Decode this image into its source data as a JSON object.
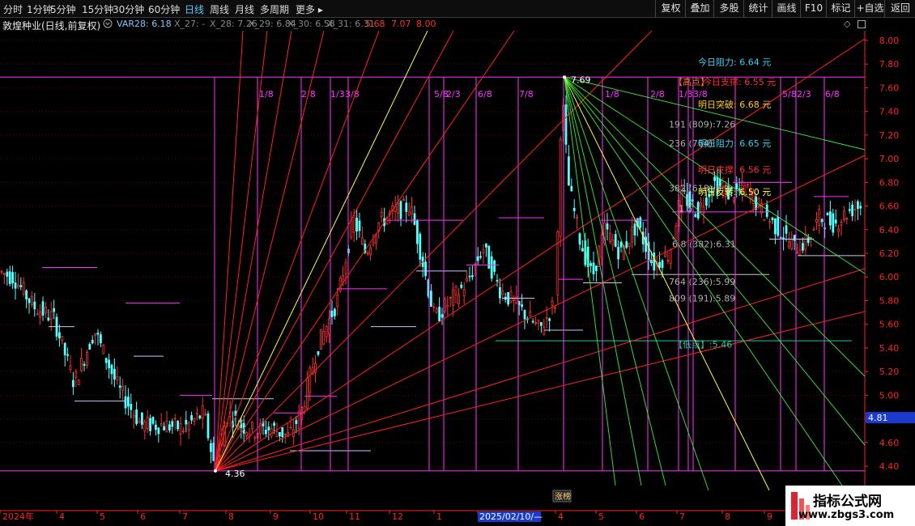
{
  "toolbar": {
    "periods": [
      {
        "label": "分时",
        "active": false
      },
      {
        "label": "1分钟",
        "active": false
      },
      {
        "label": "5分钟",
        "active": false
      },
      {
        "label": "15分钟",
        "active": false
      },
      {
        "label": "30分钟",
        "active": false
      },
      {
        "label": "60分钟",
        "active": false
      },
      {
        "label": "日线",
        "active": true
      },
      {
        "label": "周线",
        "active": false
      },
      {
        "label": "月线",
        "active": false
      },
      {
        "label": "多周期",
        "active": false
      },
      {
        "label": "更多 ▸",
        "active": false
      }
    ],
    "buttons": [
      "复权",
      "叠加",
      "多股",
      "统计",
      "画线",
      "F10",
      "标记",
      "+自选",
      "返回"
    ]
  },
  "infobar": {
    "title": "敦煌种业(日线,前复权)",
    "dropdown_icon": "chevron-down-circle-icon",
    "items": [
      {
        "text": "VAR28: 6.18",
        "color": "#7ec8ff"
      },
      {
        "text": "X_27: -",
        "color": "#888888"
      },
      {
        "text": "X_28: 7.26",
        "color": "#888888"
      },
      {
        "text": "X_29: 6.84",
        "color": "#888888"
      },
      {
        "text": "X_30: 6.58",
        "color": "#888888"
      },
      {
        "text": "X_31: 6.31",
        "color": "#888888"
      },
      {
        "text": "5.68",
        "color": "#ff3030"
      },
      {
        "text": "7.07",
        "color": "#ff3030"
      },
      {
        "text": "8.00",
        "color": "#ff3030"
      }
    ]
  },
  "chart_data": {
    "type": "candlestick",
    "title": "敦煌种业(日线,前复权)",
    "y_axis": {
      "ticks": [
        8.0,
        7.8,
        7.6,
        7.4,
        7.2,
        7.0,
        6.8,
        6.6,
        6.4,
        6.2,
        6.0,
        5.8,
        5.6,
        5.4,
        5.2,
        5.0,
        4.8,
        4.6,
        4.4
      ],
      "min": 4.3,
      "max": 8.05
    },
    "x_axis": {
      "labels": [
        "2024年",
        "4",
        "5",
        "6",
        "7",
        "8",
        "9",
        "10",
        "11",
        "12",
        "1",
        "2025/02/10/—",
        "4",
        "5",
        "6",
        "7",
        "8",
        "9"
      ]
    },
    "current_price": "4.81",
    "low_point": {
      "label": "4.36",
      "value": 4.36
    },
    "high_point": {
      "label": "7.69",
      "value": 7.69
    },
    "fraction_labels_left": [
      "1/8",
      "2/8",
      "1/3",
      "3/8",
      "5/8",
      "2/3",
      "6/8",
      "7/8"
    ],
    "fraction_labels_right": [
      "1/8",
      "2/8",
      "1/3",
      "3/8",
      "5/8",
      "2/3",
      "6/8"
    ],
    "annotations": [
      {
        "text": "今日阻力:",
        "value": "6.64 元",
        "color": "#34d0f0"
      },
      {
        "text": "【高点】",
        "value": "",
        "color": "#ff6a2a"
      },
      {
        "text": "今日支撑:",
        "value": "6.55 元",
        "color": "#ff3030"
      },
      {
        "text": "明日突破:",
        "value": "6.68 元",
        "color": "#ffd020"
      },
      {
        "text": "191 (809):7.26",
        "value": "",
        "color": "#b0b0b0"
      },
      {
        "text": "236 (764):",
        "value": "",
        "color": "#b0b0b0"
      },
      {
        "text": "明日阻力:",
        "value": "6.65 元",
        "color": "#34d0f0"
      },
      {
        "text": "明日支撑:",
        "value": "6.56 元",
        "color": "#ff3030"
      },
      {
        "text": "382 (618):6.9",
        "value": "",
        "color": "#b0b0b0"
      },
      {
        "text": "明日反转:",
        "value": "6.50 元",
        "color": "#ffff40"
      },
      {
        "text": "1 5",
        "value": "",
        "color": "#b0b0b0"
      },
      {
        "text": "6 8 (382):6.31",
        "value": "",
        "color": "#b0b0b0"
      },
      {
        "text": "764 (236):5.99",
        "value": "",
        "color": "#b0b0b0"
      },
      {
        "text": "809 (191):5.89",
        "value": "",
        "color": "#b0b0b0"
      },
      {
        "text": "【低点】:5.46",
        "value": "",
        "color": "#20c8a0"
      }
    ],
    "bottom_tag": "涨榜",
    "colors": {
      "up": "#ff3232",
      "down": "#54ffff",
      "magenta": "#ff30ff",
      "yellow": "#ffff40",
      "green": "#40ff40",
      "axis": "#ff2020"
    }
  },
  "watermark": {
    "line1": "指标公式网",
    "line2": "www.zbgs3.com"
  }
}
